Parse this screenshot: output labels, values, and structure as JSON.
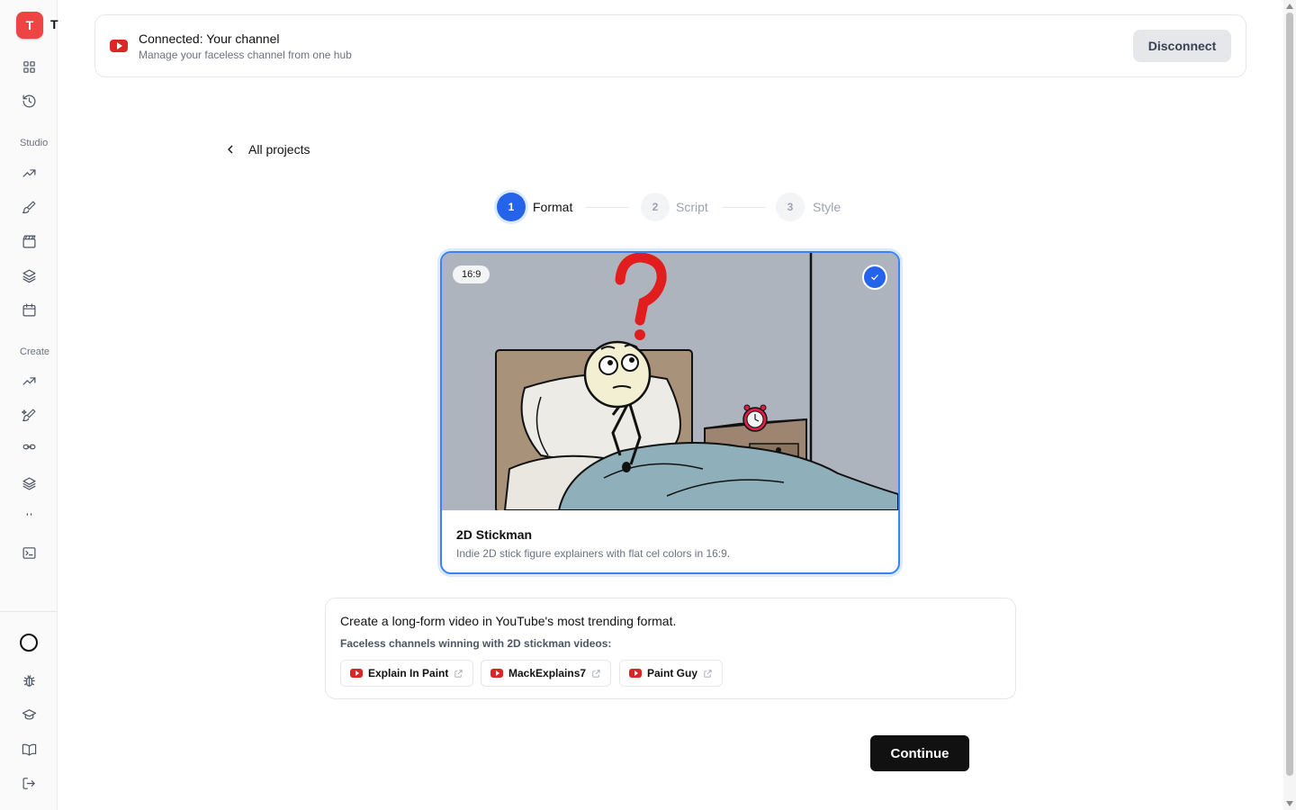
{
  "sidebar": {
    "logo_text": "T",
    "logo_badge_text": "T",
    "sections": {
      "studio": "Studio",
      "create": "Create"
    },
    "icons": [
      "grid-icon",
      "history-icon",
      "trending-icon",
      "brush-icon",
      "clapperboard-icon",
      "layers-icon",
      "calendar-icon",
      "trending-icon",
      "brush-sparkle-icon",
      "link-icon",
      "stack-icon",
      "dots-icon",
      "terminal-icon",
      "circle-icon",
      "bug-icon",
      "graduation-cap-icon",
      "book-icon",
      "logout-icon"
    ]
  },
  "banner": {
    "title": "Connected: Your channel",
    "subtitle": "Manage your faceless channel from one hub",
    "disconnect_label": "Disconnect"
  },
  "back_link": {
    "label": "All projects"
  },
  "stepper": [
    {
      "number": "1",
      "label": "Format",
      "active": true
    },
    {
      "number": "2",
      "label": "Script",
      "active": false
    },
    {
      "number": "3",
      "label": "Style",
      "active": false
    }
  ],
  "format_card": {
    "ratio": "16:9",
    "selected": true,
    "title": "2D Stickman",
    "description": "Indie 2D stick figure explainers with flat cel colors in 16:9."
  },
  "info": {
    "title": "Create a long-form video in YouTube's most trending format.",
    "subtitle": "Faceless channels winning with 2D stickman videos:",
    "channels": [
      "Explain In Paint",
      "MackExplains7",
      "Paint Guy"
    ]
  },
  "continue_label": "Continue",
  "colors": {
    "accent": "#2563eb",
    "brand": "#ef4444",
    "youtube": "#dc2626",
    "primary_button": "#111111"
  }
}
